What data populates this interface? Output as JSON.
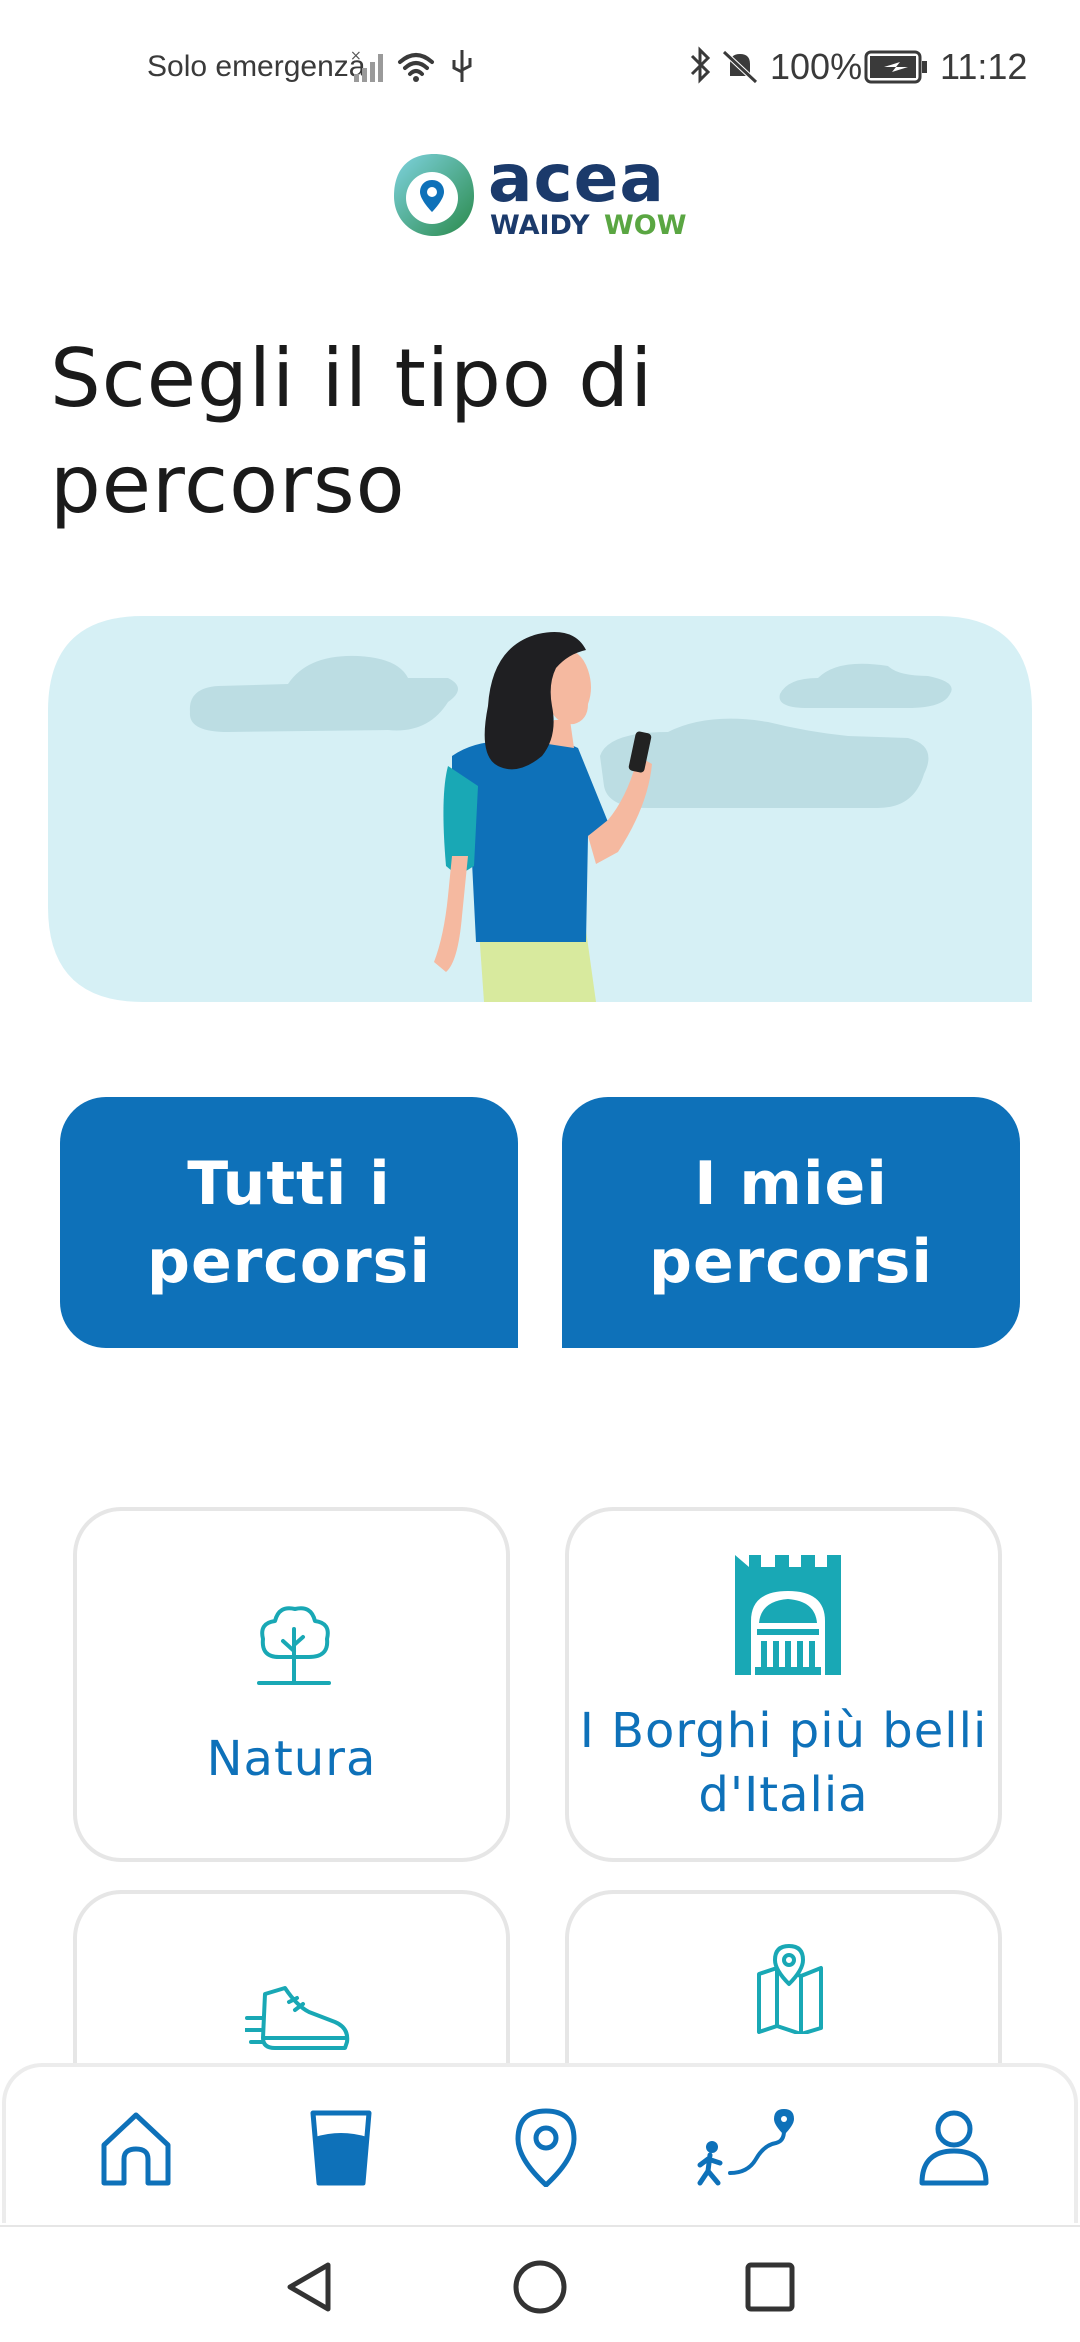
{
  "status_bar": {
    "carrier": "Solo emergenza",
    "battery": "100%",
    "time": "11:12"
  },
  "logo": {
    "word": "acea",
    "tag_left": "WAIDY",
    "tag_right": "WOW"
  },
  "title": "Scegli il tipo di percorso",
  "buttons": {
    "all_routes": "Tutti i percorsi",
    "my_routes": "I miei percorsi"
  },
  "categories": [
    {
      "label": "Natura",
      "icon": "tree-icon"
    },
    {
      "label": "I Borghi più belli d'Italia",
      "icon": "borgo-icon"
    },
    {
      "label": "",
      "icon": "sneaker-icon"
    },
    {
      "label": "",
      "icon": "map-icon"
    }
  ],
  "bottom_nav": [
    {
      "name": "home-icon"
    },
    {
      "name": "water-glass-icon"
    },
    {
      "name": "location-pin-icon"
    },
    {
      "name": "route-icon"
    },
    {
      "name": "profile-icon"
    }
  ],
  "colors": {
    "primary": "#0e71b9",
    "teal": "#19a8b5",
    "sky": "#d6f0f5",
    "text": "#1a1a1a"
  }
}
